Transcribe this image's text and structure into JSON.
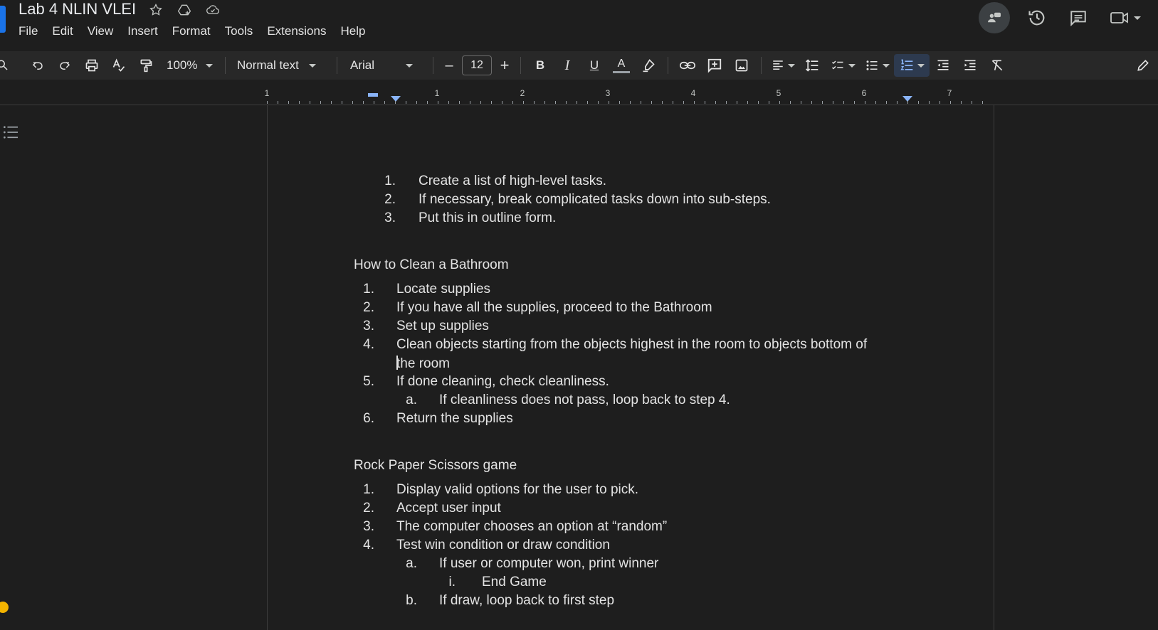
{
  "app": {
    "doc_title": "Lab 4 NLIN VLEI",
    "menu": [
      "File",
      "Edit",
      "View",
      "Insert",
      "Format",
      "Tools",
      "Extensions",
      "Help"
    ]
  },
  "toolbar": {
    "zoom": "100%",
    "style": "Normal text",
    "font": "Arial",
    "font_size": "12",
    "minus": "–",
    "plus": "+",
    "bold": "B",
    "italic": "I",
    "underline": "U",
    "text_color": "A"
  },
  "ruler": {
    "numbers": [
      "1",
      "1",
      "2",
      "3",
      "4",
      "5",
      "6",
      "7"
    ]
  },
  "document": {
    "intro_list": [
      {
        "n": "1.",
        "text": "Create a list of high-level tasks."
      },
      {
        "n": "2.",
        "text": "If necessary, break complicated tasks down into sub-steps."
      },
      {
        "n": "3.",
        "text": "Put this in outline form."
      }
    ],
    "bathroom_heading": "How to Clean a Bathroom",
    "bathroom_list": [
      {
        "n": "1.",
        "text": "Locate supplies"
      },
      {
        "n": "2.",
        "text": "If you have all the supplies, proceed to the Bathroom"
      },
      {
        "n": "3.",
        "text": "Set up supplies"
      },
      {
        "n": "4.",
        "text": "Clean objects starting from the objects highest in the room to objects bottom of"
      },
      {
        "n": "",
        "text": "the room"
      },
      {
        "n": "5.",
        "text": "If done cleaning, check cleanliness."
      },
      {
        "n": "a.",
        "text": "If cleanliness does not pass, loop back to step 4."
      },
      {
        "n": "6.",
        "text": "Return the supplies"
      }
    ],
    "rps_heading": "Rock Paper Scissors game",
    "rps_list": [
      {
        "n": "1.",
        "text": "Display valid options for the user to pick."
      },
      {
        "n": "2.",
        "text": "Accept user input"
      },
      {
        "n": "3.",
        "text": "The computer chooses an option at “random”"
      },
      {
        "n": "4.",
        "text": "Test win condition or draw condition"
      },
      {
        "n": "a.",
        "text": "If user or computer won, print winner"
      },
      {
        "n": "i.",
        "text": "End Game"
      },
      {
        "n": "b.",
        "text": "If draw, loop back to first step"
      }
    ]
  }
}
